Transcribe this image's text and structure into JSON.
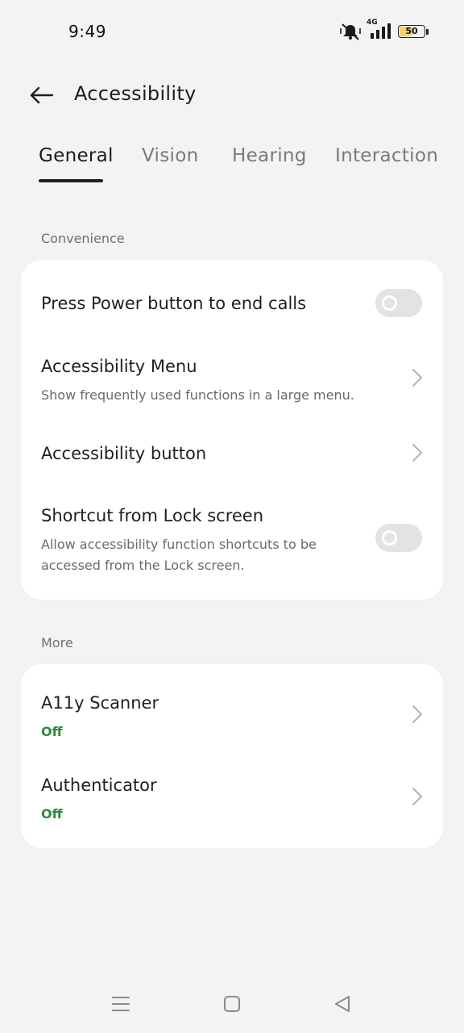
{
  "status_bar": {
    "time": "9:49",
    "network_label": "4G",
    "battery_level": "50",
    "icons": [
      "mute-vibrate-icon",
      "signal-icon",
      "battery-icon"
    ]
  },
  "header": {
    "title": "Accessibility",
    "back_icon": "back-arrow-icon"
  },
  "tabs": [
    {
      "label": "General",
      "active": true
    },
    {
      "label": "Vision",
      "active": false
    },
    {
      "label": "Hearing",
      "active": false
    },
    {
      "label": "Interaction",
      "active": false
    }
  ],
  "sections": {
    "convenience": {
      "label": "Convenience",
      "items": [
        {
          "title": "Press Power button to end calls",
          "control": "toggle",
          "on": false
        },
        {
          "title": "Accessibility Menu",
          "subtitle": "Show frequently used functions in a large menu.",
          "control": "chevron"
        },
        {
          "title": "Accessibility button",
          "control": "chevron"
        },
        {
          "title": "Shortcut from Lock screen",
          "subtitle": "Allow accessibility function shortcuts to be accessed from the Lock screen.",
          "control": "toggle",
          "on": false
        }
      ]
    },
    "more": {
      "label": "More",
      "items": [
        {
          "title": "A11y Scanner",
          "status": "Off",
          "control": "chevron"
        },
        {
          "title": "Authenticator",
          "status": "Off",
          "control": "chevron"
        }
      ]
    }
  },
  "colors": {
    "background": "#f3f3f3",
    "card": "#ffffff",
    "status_green": "#2e8b3a",
    "toggle_off": "#e3e3e3"
  },
  "nav_bar": {
    "icons": [
      "menu-icon",
      "home-icon",
      "back-triangle-icon"
    ]
  }
}
